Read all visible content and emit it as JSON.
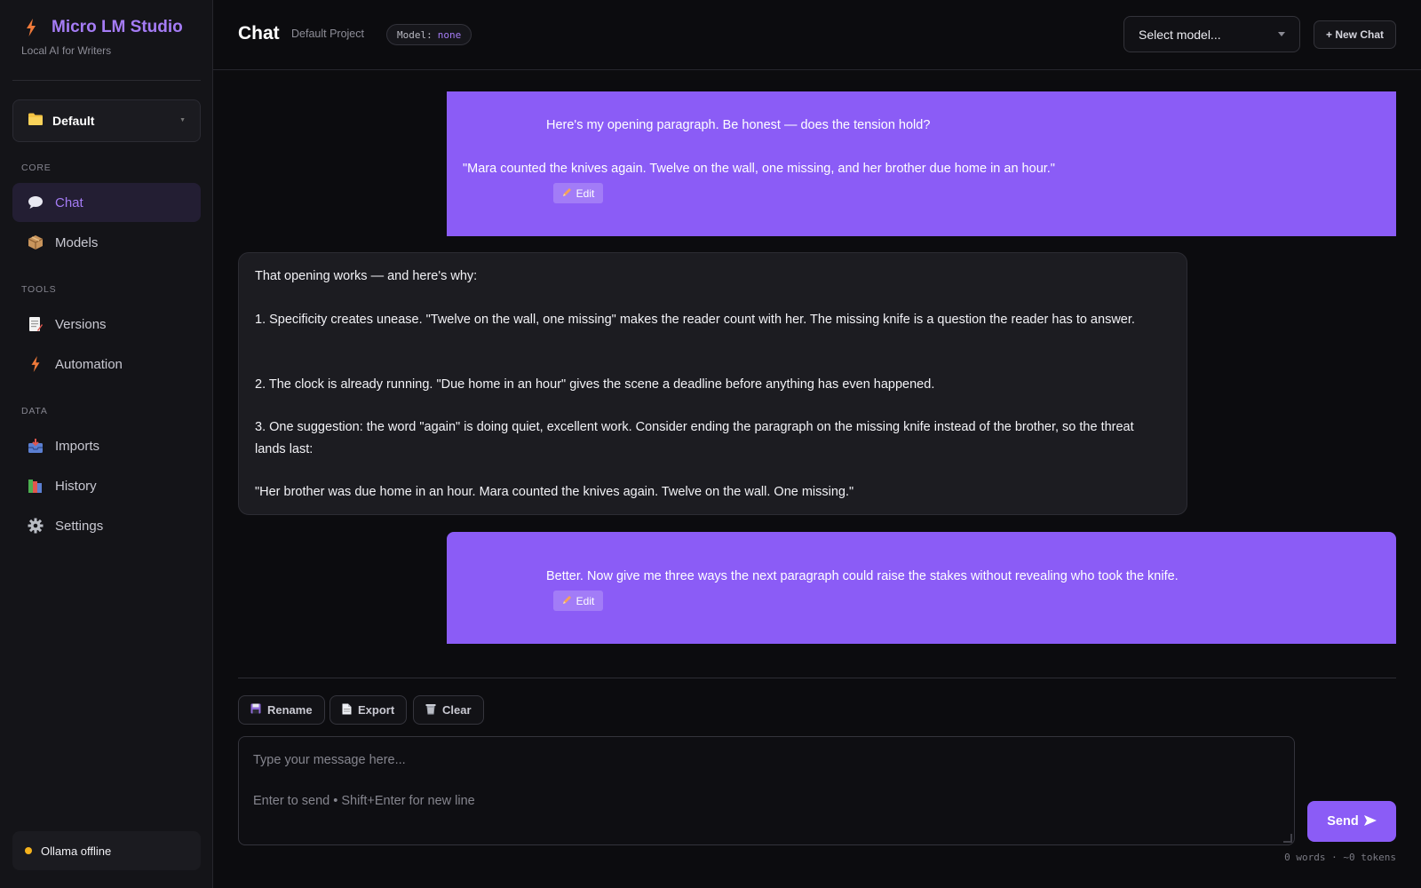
{
  "app": {
    "name": "Micro LM Studio",
    "tagline": "Local AI for Writers"
  },
  "sidebar": {
    "project": "Default",
    "sections": {
      "core": "CORE",
      "tools": "TOOLS",
      "data": "DATA"
    },
    "items": [
      {
        "label": "Chat",
        "icon": "chat-bubble-icon",
        "active": true
      },
      {
        "label": "Models",
        "icon": "package-icon"
      },
      {
        "label": "Versions",
        "icon": "memo-icon"
      },
      {
        "label": "Automation",
        "icon": "lightning-icon"
      },
      {
        "label": "Imports",
        "icon": "inbox-icon"
      },
      {
        "label": "History",
        "icon": "books-icon"
      },
      {
        "label": "Settings",
        "icon": "gear-icon"
      }
    ],
    "status": {
      "text": "Ollama offline",
      "color": "#f5b21c"
    }
  },
  "header": {
    "title": "Chat",
    "project": "Default Project",
    "model_badge_label": "Model:",
    "model_badge_value": "none",
    "model_select": "Select model...",
    "new_chat": "+ New Chat"
  },
  "messages": [
    {
      "role": "user",
      "lines": [
        "Here's my opening paragraph. Be honest — does the tension hold?",
        "\"Mara counted the knives again. Twelve on the wall, one missing, and her brother due home in an hour.\""
      ],
      "edit_label": "Edit"
    },
    {
      "role": "assistant",
      "paragraphs": [
        "That opening works — and here's why:",
        "1. Specificity creates unease. \"Twelve on the wall, one missing\" makes the reader count with her. The missing knife is a question the reader has to answer.",
        "2. The clock is already running. \"Due home in an hour\" gives the scene a deadline before anything has even happened.",
        "3. One suggestion: the word \"again\" is doing quiet, excellent work. Consider ending the paragraph on the missing knife instead of the brother, so the threat lands last:",
        "\"Her brother was due home in an hour. Mara counted the knives again. Twelve on the wall. One missing.\""
      ]
    },
    {
      "role": "user",
      "lines": [
        "Better. Now give me three ways the next paragraph could raise the stakes without revealing who took the knife."
      ],
      "edit_label": "Edit"
    }
  ],
  "composer": {
    "rename": "Rename",
    "export": "Export",
    "clear": "Clear",
    "placeholder_line1": "Type your message here...",
    "placeholder_line2": "Enter to send • Shift+Enter for new line",
    "send": "Send",
    "counter": "0 words · ~0 tokens"
  },
  "colors": {
    "accent": "#8b5cf6",
    "accent_text": "#a57cf5",
    "background": "#0c0c0f",
    "sidebar": "#141418"
  }
}
